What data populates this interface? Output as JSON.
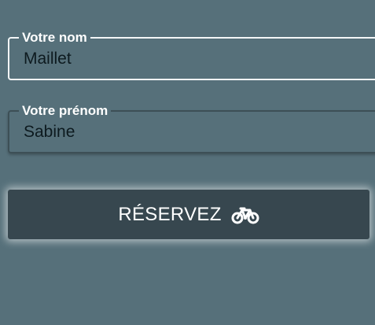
{
  "form": {
    "nom": {
      "label": "Votre nom",
      "value": "Maillet"
    },
    "prenom": {
      "label": "Votre prénom",
      "value": "Sabine"
    },
    "submit": {
      "label": "RÉSERVEZ",
      "icon": "bicycle-icon"
    }
  },
  "colors": {
    "background": "#56707a",
    "button": "#37474f",
    "text_light": "#ffffff",
    "text_dark": "#0d1a1f"
  }
}
